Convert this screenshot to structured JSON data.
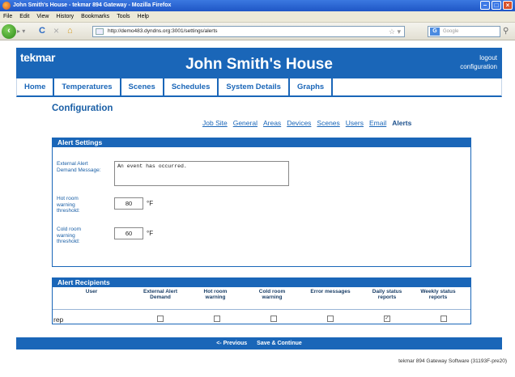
{
  "browser": {
    "window_title": "John Smith's House - tekmar 894 Gateway - Mozilla Firefox",
    "menu": [
      "File",
      "Edit",
      "View",
      "History",
      "Bookmarks",
      "Tools",
      "Help"
    ],
    "url": "http://demo483.dyndns.org:3001/settings/alerts",
    "search_placeholder": "Google"
  },
  "header": {
    "logo": "tekmar",
    "title": "John Smith's House",
    "links": [
      "logout",
      "configuration"
    ]
  },
  "tabs": [
    "Home",
    "Temperatures",
    "Scenes",
    "Schedules",
    "System Details",
    "Graphs"
  ],
  "section_title": "Configuration",
  "subnav": {
    "items": [
      "Job Site",
      "General",
      "Areas",
      "Devices",
      "Scenes",
      "Users",
      "Email",
      "Alerts"
    ],
    "active": "Alerts"
  },
  "alert_settings": {
    "heading": "Alert Settings",
    "external_label": "External Alert Demand Message:",
    "external_value": "An event has occurred.",
    "hot_label": "Hot room warning threshold:",
    "hot_value": "80",
    "cold_label": "Cold room warning threshold:",
    "cold_value": "60",
    "unit": "°F"
  },
  "alert_recipients": {
    "heading": "Alert Recipients",
    "columns": [
      "User",
      "External Alert Demand",
      "Hot room warning",
      "Cold room warning",
      "Error messages",
      "Daily status reports",
      "Weekly status reports"
    ],
    "rows": [
      {
        "user": "rep",
        "checks": [
          false,
          false,
          false,
          false,
          true,
          false
        ]
      }
    ]
  },
  "footer": {
    "previous": "<- Previous",
    "save": "Save & Continue",
    "software": "tekmar 894 Gateway Software (31193F-pre20)"
  }
}
